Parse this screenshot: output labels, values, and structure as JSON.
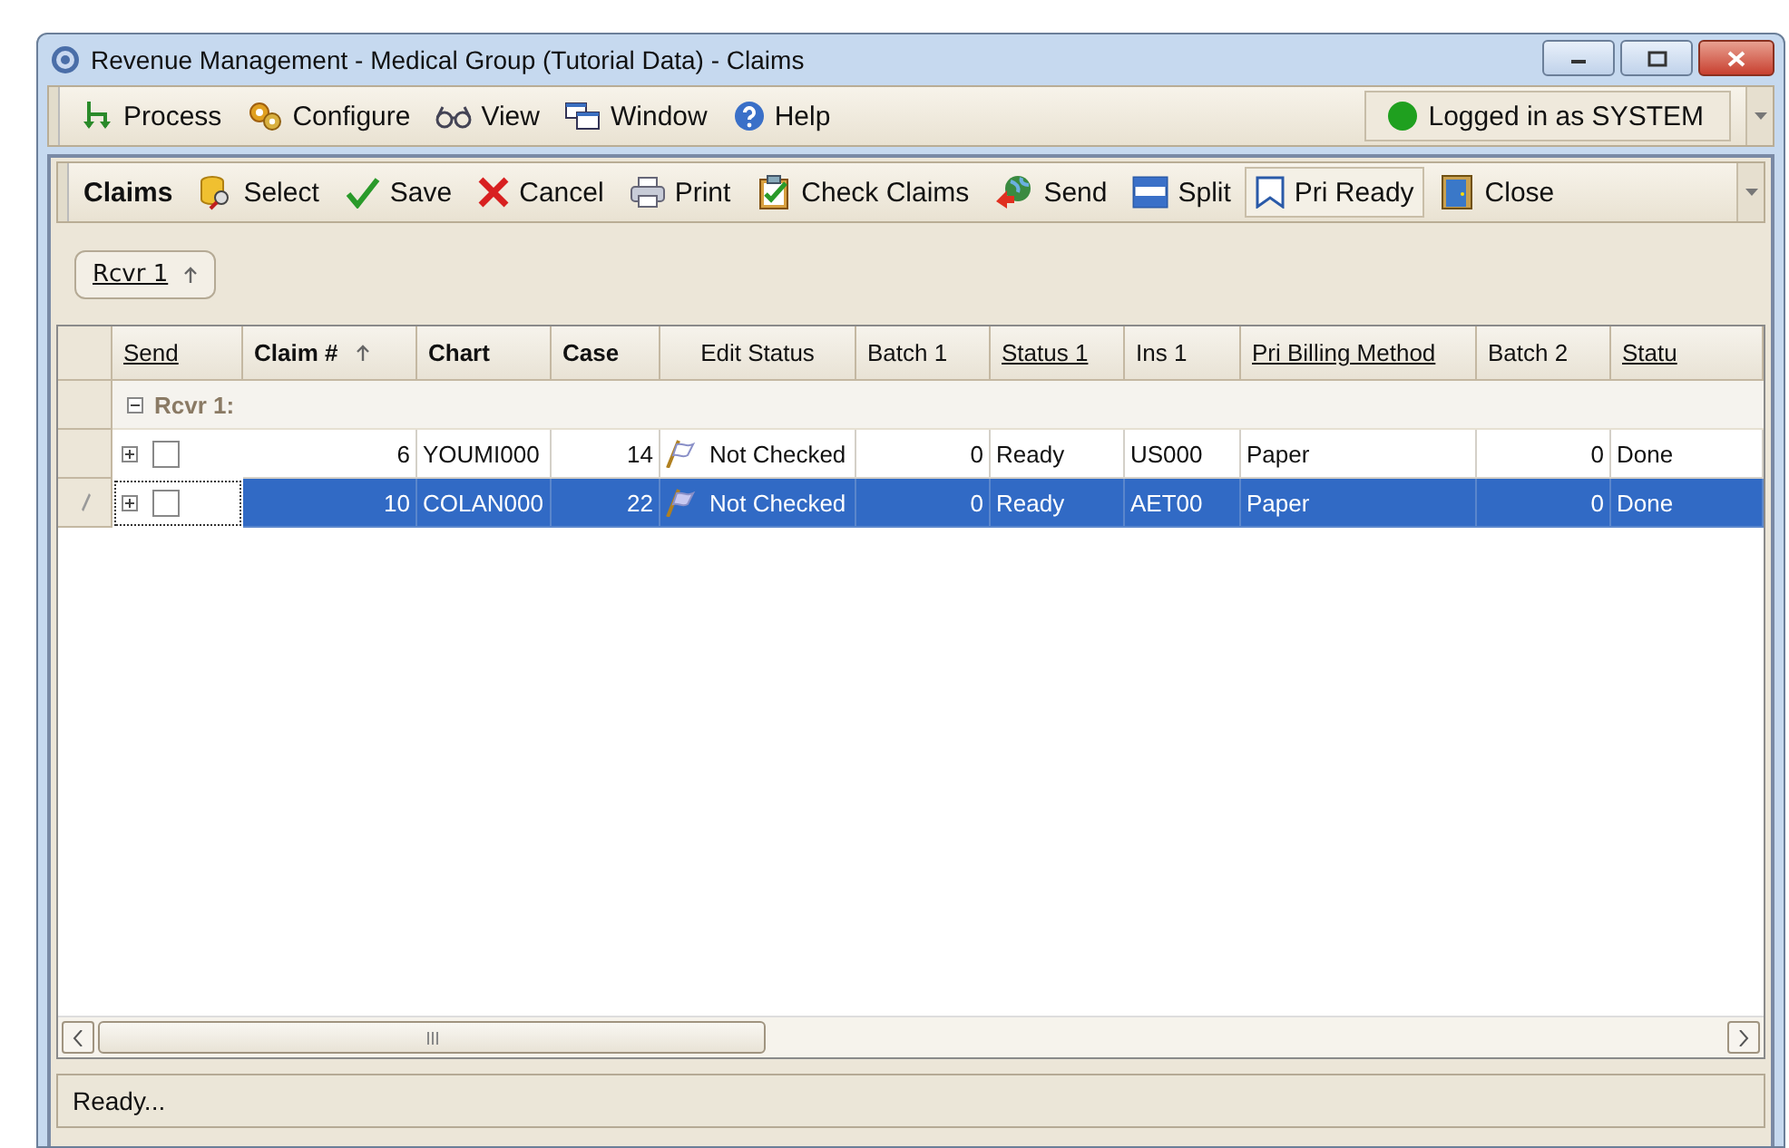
{
  "window": {
    "title": "Revenue Management - Medical Group (Tutorial Data) - Claims"
  },
  "menu": [
    {
      "label": "Process"
    },
    {
      "label": "Configure"
    },
    {
      "label": "View"
    },
    {
      "label": "Window"
    },
    {
      "label": "Help"
    }
  ],
  "login_status": {
    "text": "Logged in as SYSTEM",
    "online": true
  },
  "toolbar": {
    "title": "Claims",
    "buttons": [
      {
        "label": "Select",
        "pressed": false
      },
      {
        "label": "Save",
        "pressed": false
      },
      {
        "label": "Cancel",
        "pressed": false
      },
      {
        "label": "Print",
        "pressed": false
      },
      {
        "label": "Check Claims",
        "pressed": false
      },
      {
        "label": "Send",
        "pressed": false
      },
      {
        "label": "Split",
        "pressed": false
      },
      {
        "label": "Pri Ready",
        "pressed": true
      },
      {
        "label": "Close",
        "pressed": false
      }
    ]
  },
  "group_by": [
    {
      "label": "Rcvr 1",
      "sorted": true
    }
  ],
  "table": {
    "columns": [
      {
        "label": "Send",
        "kind": "check",
        "underlined": true,
        "bold": false,
        "sorted": false
      },
      {
        "label": "Claim #",
        "kind": "number",
        "underlined": false,
        "bold": true,
        "sorted": true
      },
      {
        "label": "Chart",
        "kind": "text",
        "underlined": false,
        "bold": true,
        "sorted": false
      },
      {
        "label": "Case",
        "kind": "number",
        "underlined": false,
        "bold": true,
        "sorted": false
      },
      {
        "label": "Edit Status",
        "kind": "flag",
        "underlined": false,
        "bold": false,
        "sorted": false
      },
      {
        "label": "Batch 1",
        "kind": "number",
        "underlined": false,
        "bold": false,
        "sorted": false
      },
      {
        "label": "Status 1",
        "kind": "text",
        "underlined": true,
        "bold": false,
        "sorted": false
      },
      {
        "label": "Ins 1",
        "kind": "text",
        "underlined": false,
        "bold": false,
        "sorted": false
      },
      {
        "label": "Pri Billing Method",
        "kind": "text",
        "underlined": true,
        "bold": false,
        "sorted": false
      },
      {
        "label": "Batch 2",
        "kind": "number",
        "underlined": false,
        "bold": false,
        "sorted": false
      },
      {
        "label": "Statu",
        "kind": "text",
        "underlined": true,
        "bold": false,
        "sorted": false
      }
    ],
    "groups": [
      {
        "label": "Rcvr 1:",
        "expanded": true,
        "rows": [
          {
            "selected": false,
            "editing": false,
            "checked": false,
            "expanded": false,
            "cells": [
              "6",
              "YOUMI000",
              "14",
              "Not Checked",
              "0",
              "Ready",
              "US000",
              "Paper",
              "0",
              "Done"
            ]
          },
          {
            "selected": true,
            "editing": true,
            "checked": false,
            "expanded": false,
            "cells": [
              "10",
              "COLAN000",
              "22",
              "Not Checked",
              "0",
              "Ready",
              "AET00",
              "Paper",
              "0",
              "Done"
            ]
          }
        ]
      }
    ]
  },
  "status_bar": {
    "text": "Ready..."
  }
}
